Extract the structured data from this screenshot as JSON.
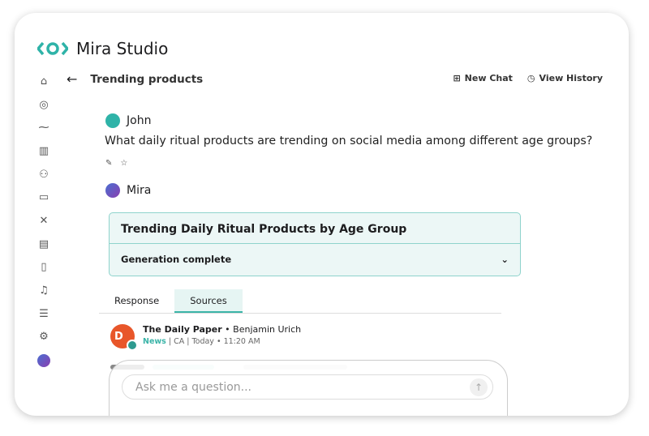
{
  "app": {
    "title": "Mira Studio",
    "brand_color": "#2fb3a8"
  },
  "sidebar": {
    "items": [
      "home-icon",
      "compass-icon",
      "activity-icon",
      "bar-chart-icon",
      "users-icon",
      "chat-icon",
      "network-icon",
      "report-icon",
      "document-icon",
      "bell-icon",
      "sliders-icon",
      "settings-icon",
      "mira-icon"
    ]
  },
  "header": {
    "back": "←",
    "title": "Trending products",
    "new_chat": "New Chat",
    "view_history": "View History"
  },
  "conversation": {
    "user_name": "John",
    "question": "What daily ritual products are trending on social media among different age groups?",
    "assistant_name": "Mira"
  },
  "card": {
    "title": "Trending Daily Ritual Products by Age Group",
    "status": "Generation complete",
    "chevron": "⌄"
  },
  "tabs": [
    {
      "label": "Response",
      "active": false
    },
    {
      "label": "Sources",
      "active": true
    }
  ],
  "source": {
    "avatar_letter": "D",
    "publication": "The Daily Paper",
    "author": "Benjamin Urich",
    "category": "News",
    "meta": "| CA | Today • 11:20 AM"
  },
  "input": {
    "placeholder": "Ask me a question..."
  }
}
